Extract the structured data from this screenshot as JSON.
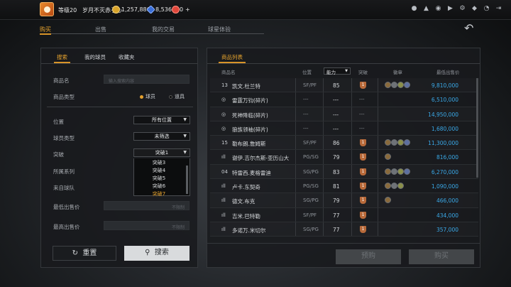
{
  "topbar": {
    "level": "等级20",
    "player_name": "岁月不灭赤子心",
    "gold": "1,257,886",
    "points": "8,536",
    "third_count": "0",
    "plus": "+"
  },
  "main_tabs": [
    {
      "label": "购买",
      "active": true
    },
    {
      "label": "出售",
      "active": false
    },
    {
      "label": "我的交易",
      "active": false
    },
    {
      "label": "球星体验",
      "active": false
    }
  ],
  "left_panel": {
    "tabs": [
      {
        "label": "搜索",
        "active": true
      },
      {
        "label": "我的球员",
        "active": false
      },
      {
        "label": "收藏夹",
        "active": false
      }
    ],
    "item_name_label": "商品名",
    "item_name_placeholder": "输入搜索内容",
    "item_type_label": "商品类型",
    "type_player": "球员",
    "type_prop": "道具",
    "position_label": "位置",
    "position_value": "所有位置",
    "player_type_label": "球员类型",
    "player_type_value": "未筛选",
    "breakthrough_label": "突破",
    "breakthrough_value": "突破1",
    "series_label": "所属系列",
    "team_label": "来自球队",
    "min_price_label": "最低出售价",
    "min_price_placeholder": "不限制",
    "max_price_label": "最高出售价",
    "max_price_placeholder": "不限制",
    "dropdown_options": [
      "突破3",
      "突破4",
      "突破5",
      "突破6",
      "突破7"
    ],
    "dropdown_highlighted": "突破7",
    "reset_label": "重置",
    "search_label": "搜索"
  },
  "right_panel": {
    "title": "商品列表",
    "columns": {
      "name": "商品名",
      "position": "位置",
      "ability": "能力",
      "breakthrough": "突破",
      "honor": "徽章",
      "price": "最低出售价"
    },
    "rows": [
      {
        "prefix": "13",
        "name": "凯文.杜兰特",
        "position": "SF/PF",
        "ability": "85",
        "breakthrough": "1",
        "medals": 4,
        "price": "9,810,000"
      },
      {
        "prefix": "◎",
        "name": "雷霆万钧(碎片)",
        "position": "---",
        "ability": "---",
        "breakthrough": "---",
        "medals": 0,
        "price": "6,510,000"
      },
      {
        "prefix": "◎",
        "name": "死神降临(碎片)",
        "position": "---",
        "ability": "---",
        "breakthrough": "---",
        "medals": 0,
        "price": "14,950,000"
      },
      {
        "prefix": "◎",
        "name": "狼族领袖(碎片)",
        "position": "---",
        "ability": "---",
        "breakthrough": "---",
        "medals": 0,
        "price": "1,680,000"
      },
      {
        "prefix": "15",
        "name": "勒布朗.詹姆斯",
        "position": "SF/PF",
        "ability": "86",
        "breakthrough": "1",
        "medals": 4,
        "price": "11,300,000"
      },
      {
        "prefix": "ıll",
        "name": "谢伊.吉尔杰斯-亚历山大",
        "position": "PG/SG",
        "ability": "79",
        "breakthrough": "1",
        "medals": 1,
        "price": "816,000"
      },
      {
        "prefix": "04",
        "name": "特雷西.麦格雷迪",
        "position": "SG/PG",
        "ability": "83",
        "breakthrough": "1",
        "medals": 4,
        "price": "6,270,000"
      },
      {
        "prefix": "ıll",
        "name": "卢卡.东契奇",
        "position": "PG/SG",
        "ability": "81",
        "breakthrough": "1",
        "medals": 3,
        "price": "1,090,000"
      },
      {
        "prefix": "ıll",
        "name": "德文.布克",
        "position": "SG/PG",
        "ability": "79",
        "breakthrough": "1",
        "medals": 1,
        "price": "466,000"
      },
      {
        "prefix": "ıll",
        "name": "吉米.巴特勒",
        "position": "SF/PF",
        "ability": "77",
        "breakthrough": "1",
        "medals": 0,
        "price": "434,000"
      },
      {
        "prefix": "ıll",
        "name": "多诺万.米切尔",
        "position": "SG/PG",
        "ability": "77",
        "breakthrough": "1",
        "medals": 0,
        "price": "357,000"
      }
    ],
    "preorder_label": "预购",
    "buy_label": "购买"
  },
  "icons": [
    "user-icon",
    "bell-icon",
    "people-icon",
    "video-icon",
    "gear-icon",
    "shield-icon",
    "headset-icon",
    "exit-icon",
    "back-arrow-icon"
  ]
}
